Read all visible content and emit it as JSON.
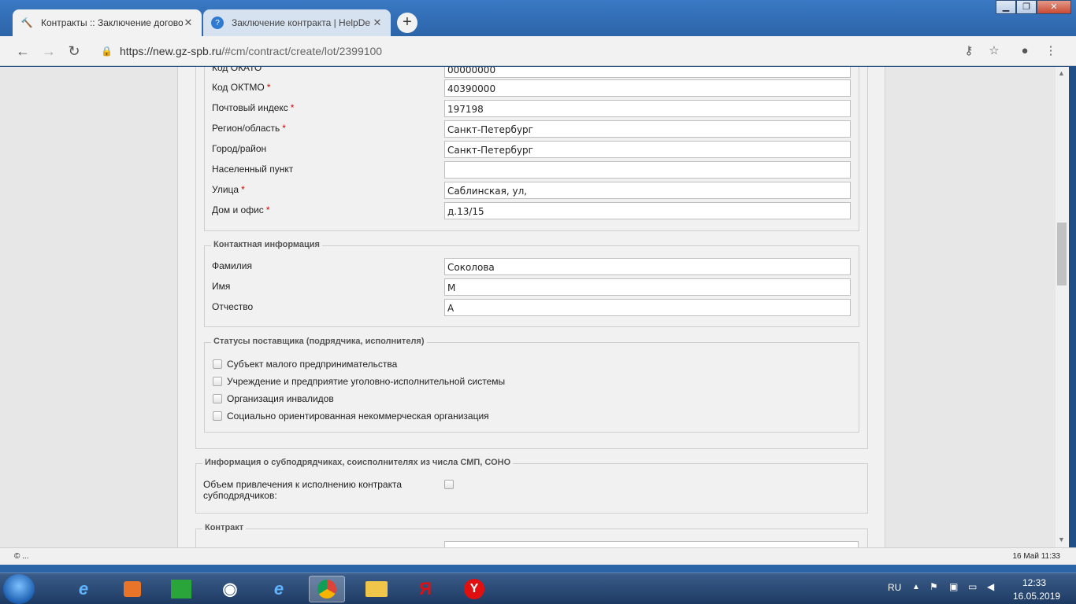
{
  "browser": {
    "tabs": [
      {
        "title": "Контракты :: Заключение догово",
        "active": true
      },
      {
        "title": "Заключение контракта | HelpDe",
        "active": false
      }
    ],
    "new_tab": "+",
    "url_host": "https://new.gz-spb.ru",
    "url_path": "/#cm/contract/create/lot/2399100"
  },
  "address": {
    "fields": [
      {
        "label": "Код ОКАТО",
        "required": false,
        "value": "00000000"
      },
      {
        "label": "Код ОКТМО",
        "required": true,
        "value": "40390000"
      },
      {
        "label": "Почтовый индекс",
        "required": true,
        "value": "197198"
      },
      {
        "label": "Регион/область",
        "required": true,
        "value": "Санкт-Петербург"
      },
      {
        "label": "Город/район",
        "required": false,
        "value": "Санкт-Петербург"
      },
      {
        "label": "Населенный пункт",
        "required": false,
        "value": ""
      },
      {
        "label": "Улица",
        "required": true,
        "value": "Саблинская, ул,"
      },
      {
        "label": "Дом и офис",
        "required": true,
        "value": "д.13/15"
      }
    ]
  },
  "contact": {
    "legend": "Контактная информация",
    "fields": [
      {
        "label": "Фамилия",
        "value": "Соколова"
      },
      {
        "label": "Имя",
        "value": "М"
      },
      {
        "label": "Отчество",
        "value": "А"
      }
    ]
  },
  "statuses": {
    "legend": "Статусы поставщика (подрядчика, исполнителя)",
    "items": [
      "Субъект малого предпринимательства",
      "Учреждение и предприятие уголовно-исполнительной системы",
      "Организация инвалидов",
      "Социально ориентированная некоммерческая организация"
    ]
  },
  "subcontractors": {
    "legend": "Информация о субподрядчиках, соисполнителях из числа СМП, СОНО",
    "label_line1": "Объем привлечения к исполнению контракта",
    "label_line2": "субподрядчиков:"
  },
  "contract": {
    "legend": "Контракт"
  },
  "status_bar": {
    "left": "© ...",
    "right": "16 Май 11:33"
  },
  "taskbar": {
    "lang": "RU",
    "time": "12:33",
    "date": "16.05.2019"
  }
}
